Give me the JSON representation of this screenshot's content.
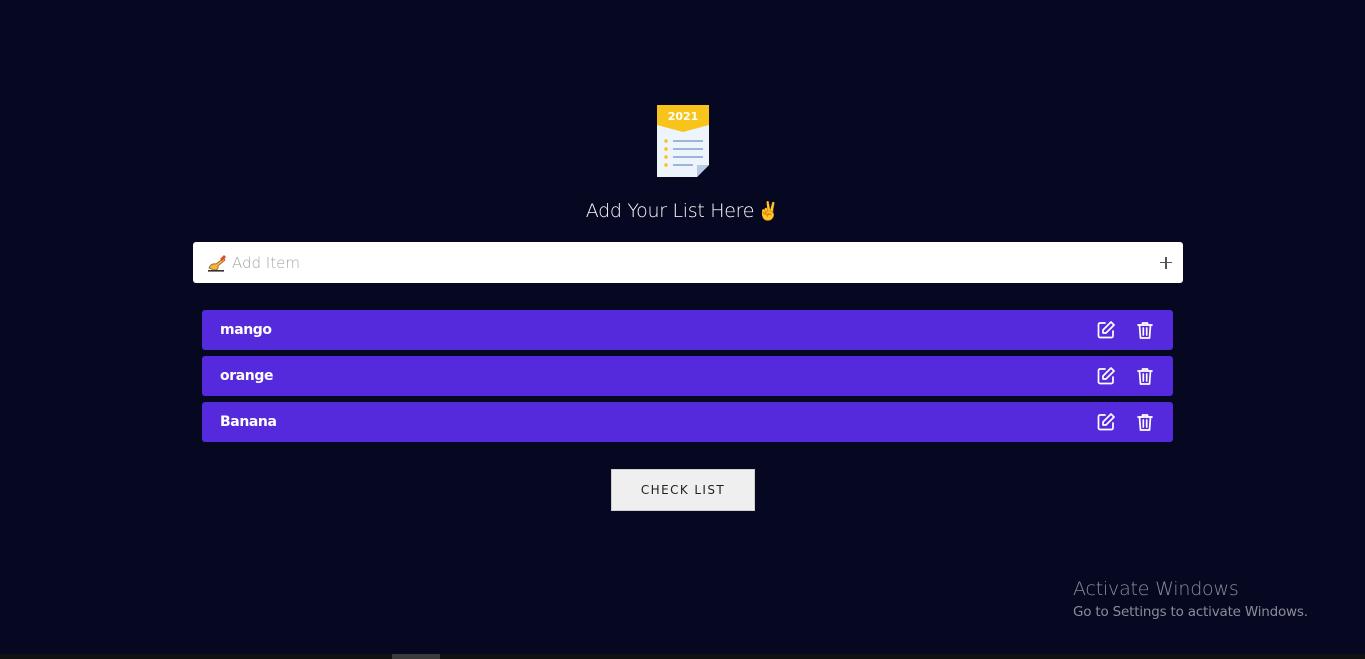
{
  "header": {
    "logo_badge": "2021",
    "logo_icon": "notepad-2021-icon",
    "title": "Add Your List Here",
    "title_emoji": "✌"
  },
  "add_bar": {
    "placeholder": "Add Item",
    "value": "",
    "leading_icon": "writing-hand-icon",
    "add_icon": "plus-icon"
  },
  "items": [
    {
      "label": "mango"
    },
    {
      "label": "orange"
    },
    {
      "label": "Banana"
    }
  ],
  "item_actions": {
    "edit_icon": "edit-icon",
    "delete_icon": "trash-icon"
  },
  "check_button": {
    "label": "CHECK LIST"
  },
  "watermark": {
    "title": "Activate Windows",
    "subtitle": "Go to Settings to activate Windows."
  },
  "colors": {
    "background": "#060822",
    "item_background": "#552add",
    "accent_yellow": "#f7c21a"
  }
}
